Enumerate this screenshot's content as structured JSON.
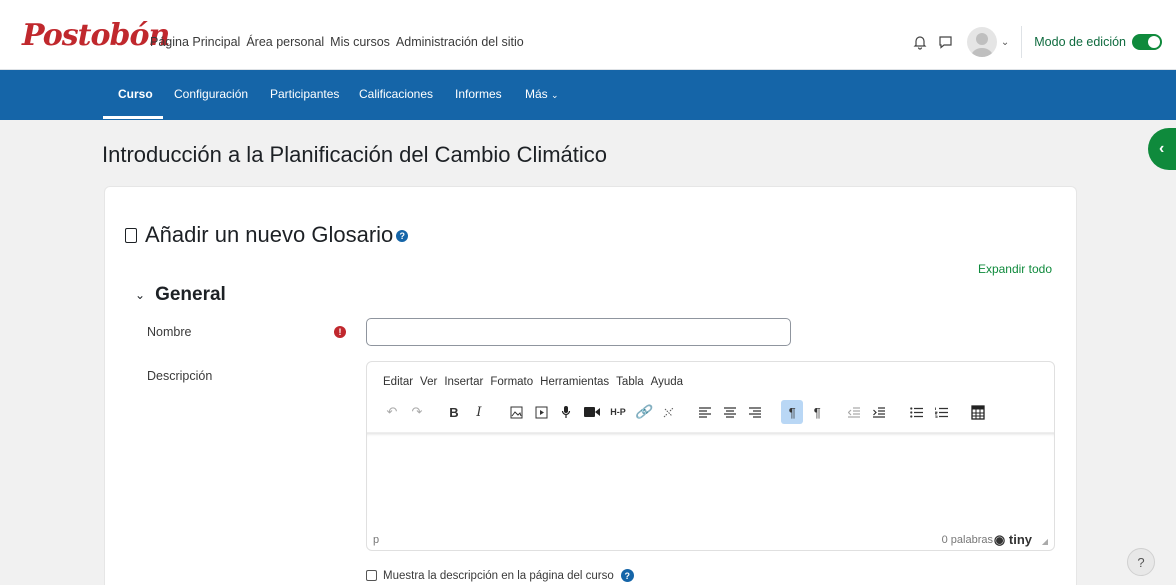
{
  "header": {
    "logo_text": "Postobón",
    "nav": [
      "Página Principal",
      "Área personal",
      "Mis cursos",
      "Administración del sitio"
    ],
    "edit_mode_label": "Modo de edición",
    "edit_mode_on": true,
    "brand_color": "#c0282d",
    "accent_green": "#0f8a3c"
  },
  "secondary_nav": {
    "items": [
      "Curso",
      "Configuración",
      "Participantes",
      "Calificaciones",
      "Informes",
      "Más"
    ],
    "active": "Curso",
    "bar_color": "#1565a8"
  },
  "course_title": "Introducción a la Planificación del Cambio Climático",
  "form": {
    "title": "Añadir un nuevo Glosario",
    "expand_all": "Expandir todo",
    "section_general": "General",
    "name_label": "Nombre",
    "name_value": "",
    "description_label": "Descripción",
    "required_icon": "exclamation-icon"
  },
  "editor": {
    "menu": [
      "Editar",
      "Ver",
      "Insertar",
      "Formato",
      "Herramientas",
      "Tabla",
      "Ayuda"
    ],
    "toolbar_icons": [
      "undo-icon",
      "redo-icon",
      "bold-icon",
      "italic-icon",
      "image-icon",
      "media-icon",
      "record-audio-icon",
      "record-video-icon",
      "h5p-icon",
      "link-icon",
      "unlink-icon",
      "align-left-icon",
      "align-center-icon",
      "align-right-icon",
      "ltr-icon",
      "rtl-icon",
      "outdent-icon",
      "indent-icon",
      "bullet-list-icon",
      "numbered-list-icon",
      "calculator-icon"
    ],
    "bold_text": "B",
    "italic_text": "I",
    "h5p_text": "H-P",
    "status_path": "p",
    "word_count": "0 palabras",
    "brand": "tiny"
  },
  "show_description_label": "Muestra la descripción en la página del curso",
  "help_button_label": "?"
}
